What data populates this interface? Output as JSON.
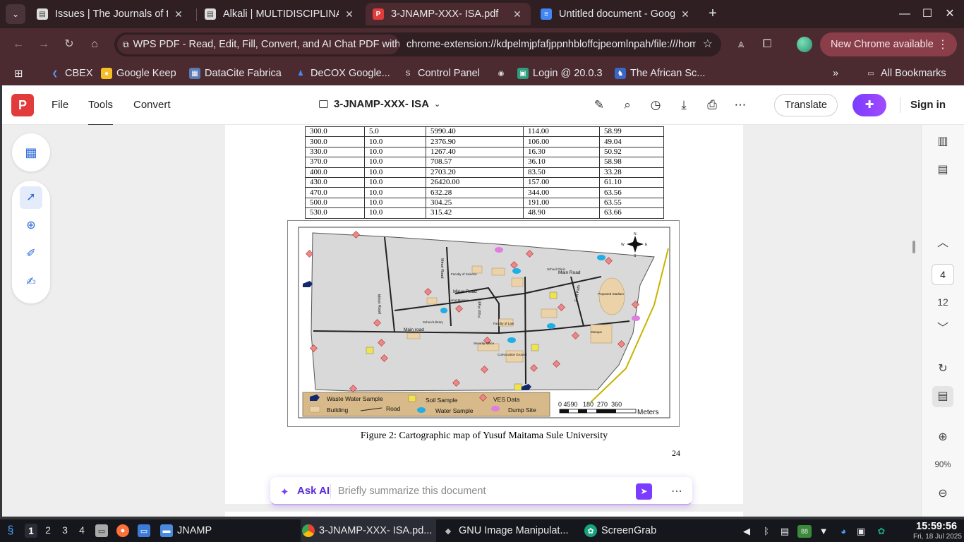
{
  "browser": {
    "tabs": [
      {
        "title": "Issues | The Journals of the",
        "active": false
      },
      {
        "title": "Alkali | MULTIDISCIPLINARY",
        "active": false
      },
      {
        "title": "3-JNAMP-XXX- ISA.pdf",
        "active": true
      },
      {
        "title": "Untitled document - Google Docs",
        "active": false
      }
    ],
    "omnibox": {
      "chip": "WPS PDF - Read, Edit, Fill, Convert, and AI Chat PDF with Ease",
      "url": "chrome-extension://kdpelmjpfafjppnhbloffcjpeomlnpah/file:///home/"
    },
    "new_chrome": "New Chrome available",
    "bookmarks": [
      "CBEX",
      "Google Keep",
      "DataCite Fabrica",
      "DeCOX Google...",
      "Control Panel",
      "",
      "Login @ 20.0.3",
      "The African Sc..."
    ],
    "all_bookmarks": "All Bookmarks"
  },
  "wps": {
    "menus": [
      "File",
      "Tools",
      "Convert"
    ],
    "doc_name": "3-JNAMP-XXX- ISA",
    "translate": "Translate",
    "sign_in": "Sign in",
    "ask_ai_label": "Ask AI",
    "ask_ai_placeholder": "Briefly summarize this document"
  },
  "document": {
    "table_rows": [
      [
        "300.0",
        "5.0",
        "5990.40",
        "114.00",
        "58.99"
      ],
      [
        "300.0",
        "10.0",
        "2376.90",
        "106.00",
        "49.04"
      ],
      [
        "330.0",
        "10.0",
        "1267.40",
        "16.30",
        "50.92"
      ],
      [
        "370.0",
        "10.0",
        "708.57",
        "36.10",
        "58.98"
      ],
      [
        "400.0",
        "10.0",
        "2703.20",
        "83.50",
        "33.28"
      ],
      [
        "430.0",
        "10.0",
        "26420.00",
        "157.00",
        "61.10"
      ],
      [
        "470.0",
        "10.0",
        "632.28",
        "344.00",
        "63.56"
      ],
      [
        "500.0",
        "10.0",
        "304.25",
        "191.00",
        "63.55"
      ],
      [
        "530.0",
        "10.0",
        "315.42",
        "48.90",
        "63.66"
      ]
    ],
    "map": {
      "road_labels": [
        "Main Road",
        "Minor Road",
        "Minor Road",
        "Minor Road",
        "Main road",
        "Foot Path",
        "Foot Path"
      ],
      "place_labels": [
        "Faculty of Science",
        "School Clinic",
        "Proposed Stadium",
        "Jumat Mosque",
        "Mosque",
        "School Library",
        "Faculty of Law",
        "Security Office",
        "Convocation Ground"
      ],
      "legend": [
        "Waste Water Sample",
        "Soil Sample",
        "VES Data",
        "Building",
        "Road",
        "Water Sample",
        "Dump Site"
      ],
      "scale_text": "0 4590   180  270  360",
      "scale_unit": "Meters",
      "north_labels": [
        "N",
        "E",
        "S",
        "W"
      ]
    },
    "caption": "Figure 2: Cartographic map of Yusuf Maitama Sule University",
    "page_number": "24"
  },
  "viewer": {
    "current_page": "4",
    "total_pages": "12",
    "zoom": "90%"
  },
  "taskbar": {
    "workspaces": [
      "1",
      "2",
      "3",
      "4"
    ],
    "folder_label": "JNAMP",
    "windows": [
      "3-JNAMP-XXX- ISA.pd...",
      "GNU Image Manipulat...",
      "ScreenGrab"
    ],
    "battery": "88",
    "time": "15:59:56",
    "date": "Fri, 18 Jul 2025"
  },
  "colors": {
    "tab_strip": "#2f1e22",
    "toolbar": "#4b2b30",
    "wps_accent": "#7b3cff",
    "map_land": "#d9d9d9",
    "map_legend_bg": "#d7b98a"
  }
}
